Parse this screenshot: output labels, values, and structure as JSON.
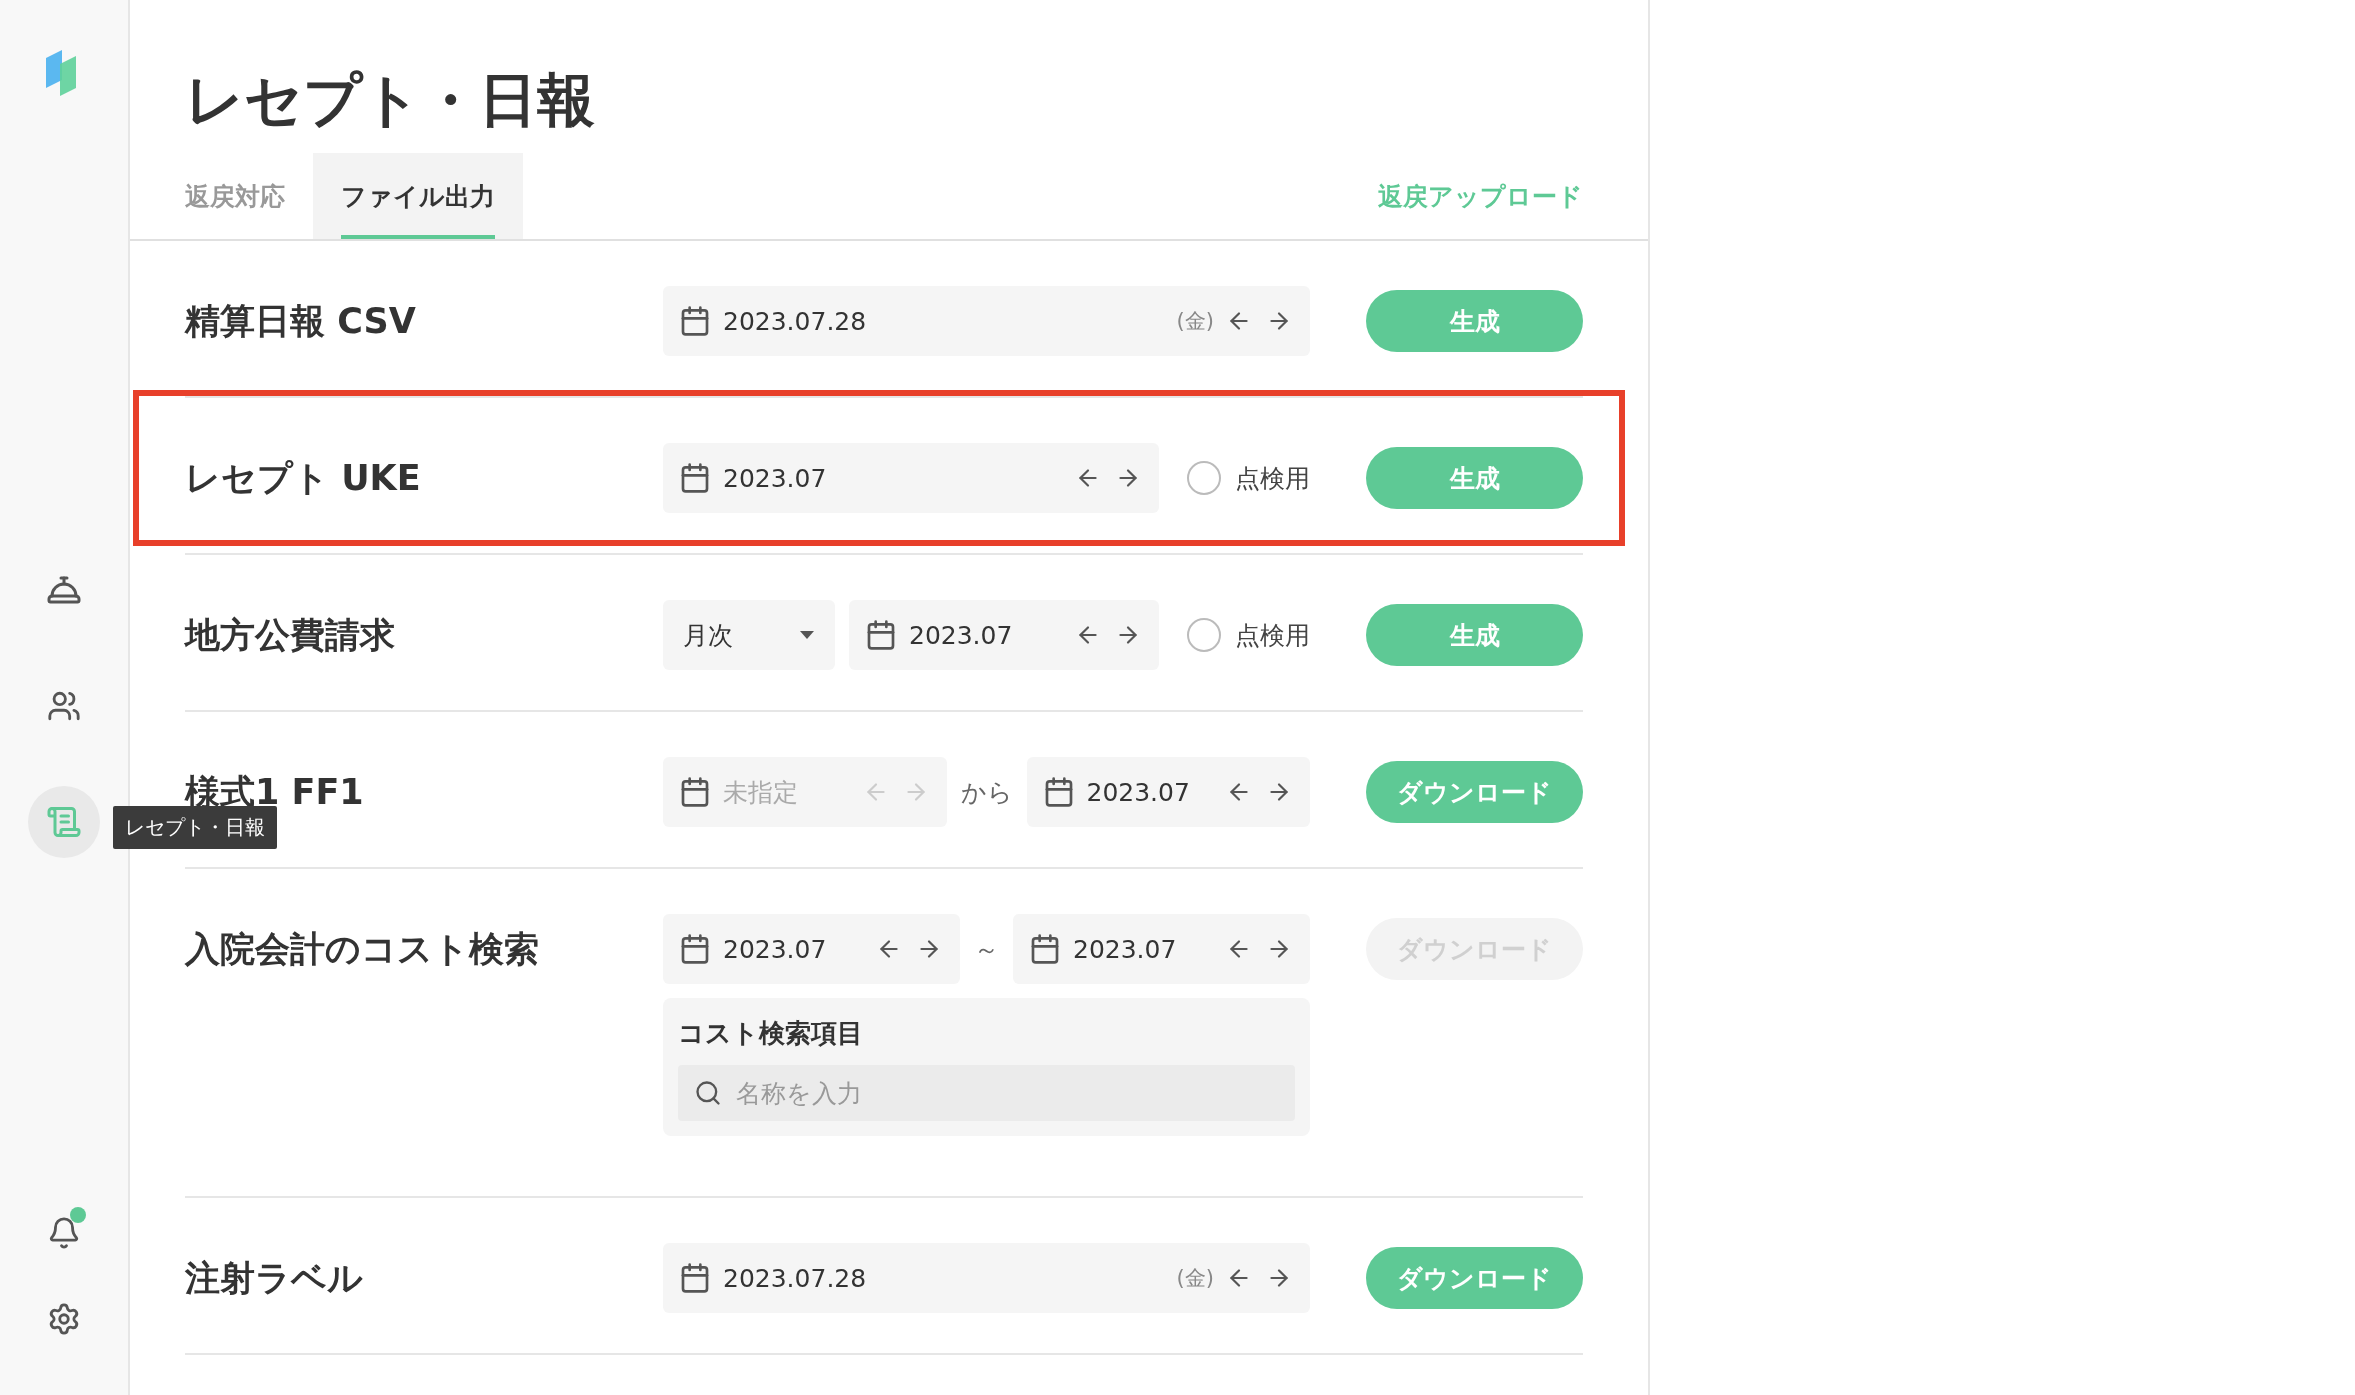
{
  "sidebar": {
    "items": [
      {
        "kind": "service",
        "selected": false
      },
      {
        "kind": "patients",
        "selected": false
      },
      {
        "kind": "receipt",
        "selected": true,
        "tooltip": "レセプト・日報"
      }
    ],
    "bottom_items": [
      {
        "kind": "notifications",
        "badge": true
      },
      {
        "kind": "settings",
        "badge": false
      }
    ]
  },
  "page": {
    "title": "レセプト・日報"
  },
  "tabs": [
    {
      "label": "返戻対応",
      "selected": false
    },
    {
      "label": "ファイル出力",
      "selected": true
    }
  ],
  "upload_link": "返戻アップロード",
  "rows": [
    {
      "label": "精算日報 CSV",
      "highlighted": false,
      "controls": [
        {
          "kind": "date",
          "value": "2023.07.28",
          "weekday": "(金)"
        }
      ],
      "button": {
        "label": "生成",
        "disabled": false
      }
    },
    {
      "label": "レセプト UKE",
      "highlighted": true,
      "controls": [
        {
          "kind": "date",
          "value": "2023.07"
        },
        {
          "kind": "radio",
          "label": "点検用",
          "checked": false
        }
      ],
      "button": {
        "label": "生成",
        "disabled": false
      }
    },
    {
      "label": "地方公費請求",
      "highlighted": false,
      "controls": [
        {
          "kind": "select",
          "value": "月次"
        },
        {
          "kind": "date",
          "value": "2023.07"
        },
        {
          "kind": "radio",
          "label": "点検用",
          "checked": false
        }
      ],
      "button": {
        "label": "生成",
        "disabled": false
      }
    },
    {
      "label": "様式1 FF1",
      "highlighted": false,
      "controls": [
        {
          "kind": "date",
          "placeholder": "未指定"
        },
        {
          "kind": "separator",
          "text": "から"
        },
        {
          "kind": "date",
          "value": "2023.07"
        }
      ],
      "button": {
        "label": "ダウンロード",
        "disabled": false
      }
    },
    {
      "label": "入院会計のコスト検索",
      "highlighted": false,
      "controls": [
        {
          "kind": "date",
          "value": "2023.07"
        },
        {
          "kind": "separator",
          "text": "～"
        },
        {
          "kind": "date",
          "value": "2023.07"
        }
      ],
      "panel": {
        "title": "コスト検索項目",
        "placeholder": "名称を入力"
      },
      "button": {
        "label": "ダウンロード",
        "disabled": true
      }
    },
    {
      "label": "注射ラベル",
      "highlighted": false,
      "controls": [
        {
          "kind": "date",
          "value": "2023.07.28",
          "weekday": "(金)"
        }
      ],
      "button": {
        "label": "ダウンロード",
        "disabled": false
      }
    }
  ]
}
